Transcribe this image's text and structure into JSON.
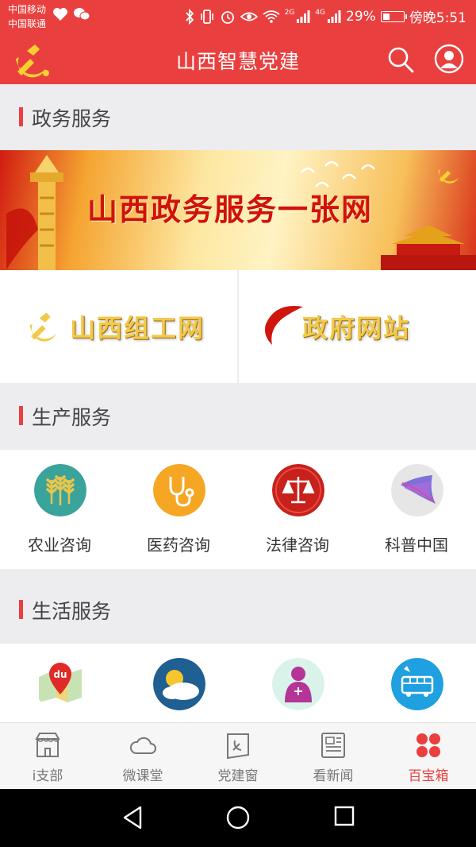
{
  "status_bar": {
    "carrier_1": "中国移动",
    "carrier_2": "中国联通",
    "signal_1_label": "2G",
    "signal_2_label": "4G",
    "battery": "29%",
    "time": "傍晚5:51"
  },
  "header": {
    "title": "山西智慧党建"
  },
  "sections": {
    "gov": {
      "title": "政务服务"
    },
    "production": {
      "title": "生产服务"
    },
    "life": {
      "title": "生活服务"
    }
  },
  "banner": {
    "text": "山西政务服务一张网"
  },
  "tiles": [
    {
      "label": "山西组工网"
    },
    {
      "label": "政府网站"
    }
  ],
  "production_items": [
    {
      "label": "农业咨询",
      "icon": "wheat-icon",
      "color": "#3aa39b"
    },
    {
      "label": "医药咨询",
      "icon": "stethoscope-icon",
      "color": "#f5a623"
    },
    {
      "label": "法律咨询",
      "icon": "scales-icon",
      "color": "#c8201b"
    },
    {
      "label": "科普中国",
      "icon": "kepu-logo-icon",
      "color": "#e6e6e6"
    }
  ],
  "life_items": [
    {
      "icon": "baidu-map-icon",
      "color": "#ffffff"
    },
    {
      "icon": "weather-icon",
      "color": "#1f5f91"
    },
    {
      "icon": "unicom-icon",
      "color": "#d9f3ea"
    },
    {
      "icon": "bus-icon",
      "color": "#1fa0e0"
    }
  ],
  "bottom_nav": [
    {
      "label": "i支部",
      "icon": "store-icon",
      "active": false
    },
    {
      "label": "微课堂",
      "icon": "cloud-icon",
      "active": false
    },
    {
      "label": "党建窗",
      "icon": "party-flag-icon",
      "active": false
    },
    {
      "label": "看新闻",
      "icon": "newspaper-icon",
      "active": false
    },
    {
      "label": "百宝箱",
      "icon": "grid-dots-icon",
      "active": true
    }
  ],
  "colors": {
    "accent": "#e9403f",
    "background": "#ededf0"
  }
}
